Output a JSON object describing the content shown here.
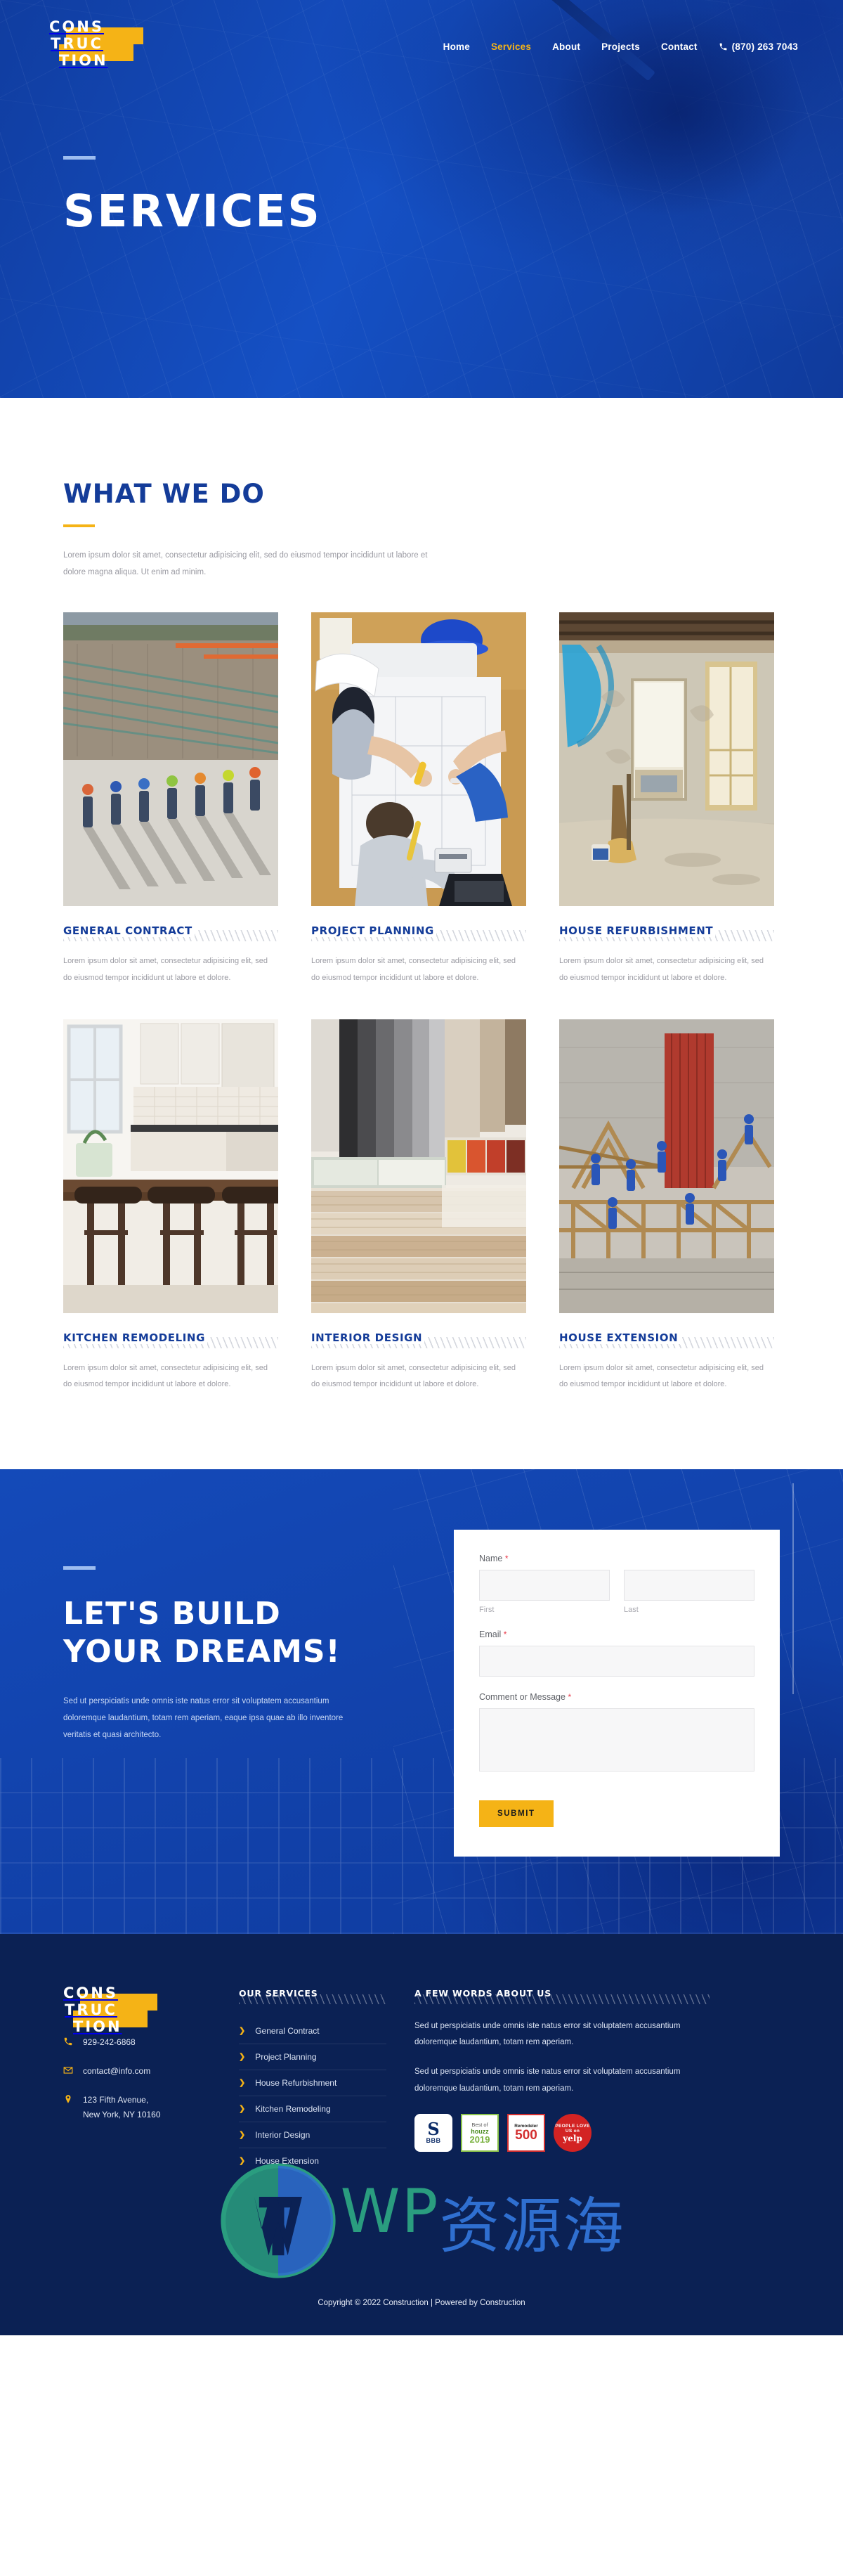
{
  "brand": {
    "line1": "CONS",
    "line2": "TRUC",
    "line3": "TION"
  },
  "nav": {
    "items": [
      {
        "label": "Home",
        "active": false
      },
      {
        "label": "Services",
        "active": true
      },
      {
        "label": "About",
        "active": false
      },
      {
        "label": "Projects",
        "active": false
      },
      {
        "label": "Contact",
        "active": false
      }
    ],
    "phone": "(870) 263 7043"
  },
  "hero": {
    "title": "SERVICES"
  },
  "what_we_do": {
    "title": "WHAT WE DO",
    "lead": "Lorem ipsum dolor sit amet, consectetur adipisicing elit, sed do eiusmod tempor incididunt ut labore et dolore magna aliqua. Ut enim ad minim.",
    "cards": [
      {
        "title": "GENERAL CONTRACT",
        "desc": "Lorem ipsum dolor sit amet, consectetur adipisicing elit, sed do eiusmod tempor incididunt ut labore et dolore."
      },
      {
        "title": "PROJECT PLANNING",
        "desc": "Lorem ipsum dolor sit amet, consectetur adipisicing elit, sed do eiusmod tempor incididunt ut labore et dolore."
      },
      {
        "title": "HOUSE REFURBISHMENT",
        "desc": "Lorem ipsum dolor sit amet, consectetur adipisicing elit, sed do eiusmod tempor incididunt ut labore et dolore."
      },
      {
        "title": "KITCHEN REMODELING",
        "desc": "Lorem ipsum dolor sit amet, consectetur adipisicing elit, sed do eiusmod tempor incididunt ut labore et dolore."
      },
      {
        "title": "INTERIOR DESIGN",
        "desc": "Lorem ipsum dolor sit amet, consectetur adipisicing elit, sed do eiusmod tempor incididunt ut labore et dolore."
      },
      {
        "title": "HOUSE EXTENSION",
        "desc": "Lorem ipsum dolor sit amet, consectetur adipisicing elit, sed do eiusmod tempor incididunt ut labore et dolore."
      }
    ]
  },
  "cta": {
    "title_line1": "LET'S BUILD",
    "title_line2": "YOUR DREAMS!",
    "text": "Sed ut perspiciatis unde omnis iste natus error sit voluptatem accusantium doloremque laudantium, totam rem aperiam, eaque ipsa quae ab illo inventore veritatis et quasi architecto."
  },
  "form": {
    "name_label": "Name",
    "first_sub": "First",
    "last_sub": "Last",
    "email_label": "Email",
    "message_label": "Comment or Message",
    "required_mark": "*",
    "first_value": "",
    "last_value": "",
    "email_value": "",
    "message_value": "",
    "submit_label": "SUBMIT"
  },
  "footer": {
    "phone": "929-242-6868",
    "email": "contact@info.com",
    "address_line1": "123 Fifth Avenue,",
    "address_line2": "New York, NY 10160",
    "services_heading": "OUR SERVICES",
    "services": [
      "General Contract",
      "Project Planning",
      "House Refurbishment",
      "Kitchen Remodeling",
      "Interior Design",
      "House Extension"
    ],
    "about_heading": "A FEW WORDS ABOUT US",
    "about_p1": "Sed ut perspiciatis unde omnis iste natus error sit voluptatem accusantium doloremque laudantium, totam rem aperiam.",
    "badges": [
      {
        "name": "bbb-badge",
        "l1": "S",
        "l2": "BBB"
      },
      {
        "name": "houzz-badge",
        "l1": "Best of",
        "l2": "houzz",
        "l3": "2019"
      },
      {
        "name": "remodeler-500-badge",
        "l1": "Remodeler",
        "l2": "500"
      },
      {
        "name": "yelp-badge",
        "l1": "PEOPLE LOVE US on",
        "l2": "yelp"
      }
    ],
    "copyright": "Copyright © 2022 Construction | Powered by Construction"
  },
  "watermark": {
    "en": "WP",
    "cn": "资源海"
  },
  "colors": {
    "brand_blue": "#1550c4",
    "deep_blue": "#0b2154",
    "title_blue": "#143c99",
    "accent_yellow": "#f5b316",
    "required_red": "#e8394a"
  }
}
